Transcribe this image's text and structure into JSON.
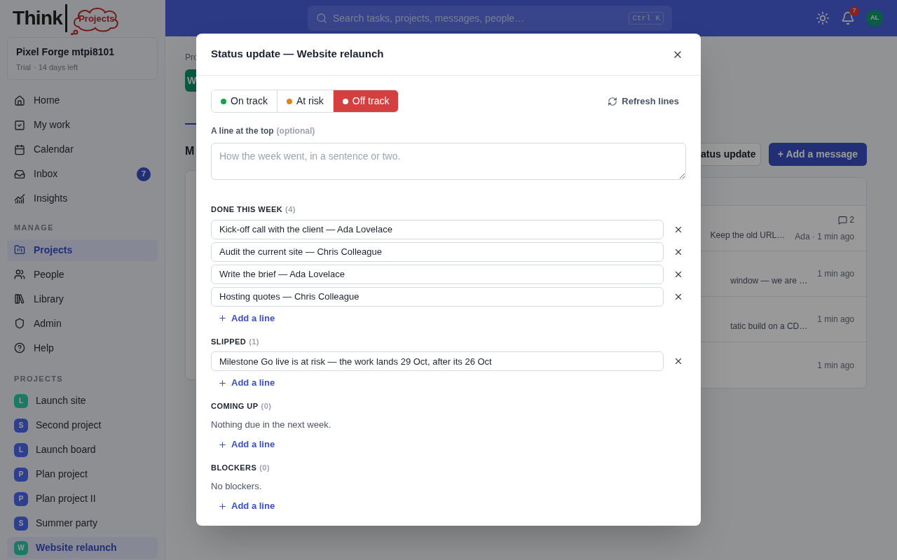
{
  "logo": {
    "word": "Think",
    "badge": "Projects"
  },
  "workspace": {
    "name": "Pixel Forge mtpi8101",
    "plan": "Trial",
    "trial_left": "· 14 days left"
  },
  "nav": [
    {
      "kind": "home",
      "label": "Home",
      "selected": false
    },
    {
      "kind": "work",
      "label": "My work",
      "selected": false
    },
    {
      "kind": "calendar",
      "label": "Calendar",
      "selected": false
    },
    {
      "kind": "inbox",
      "label": "Inbox",
      "badge": "7",
      "selected": false
    },
    {
      "kind": "insights",
      "label": "Insights",
      "selected": false
    }
  ],
  "manage": {
    "heading": "MANAGE",
    "items": [
      {
        "kind": "projects",
        "label": "Projects",
        "selected": true
      },
      {
        "kind": "people",
        "label": "People",
        "selected": false
      },
      {
        "kind": "library",
        "label": "Library",
        "selected": false
      },
      {
        "kind": "admin",
        "label": "Admin",
        "selected": false
      },
      {
        "kind": "help",
        "label": "Help",
        "selected": false
      }
    ]
  },
  "projects": {
    "heading": "PROJECTS",
    "items": [
      {
        "initial": "L",
        "label": "Launch site",
        "color": "#1a7a66",
        "selected": false
      },
      {
        "initial": "S",
        "label": "Second project",
        "color": "#2f3f8f",
        "selected": false
      },
      {
        "initial": "L",
        "label": "Launch board",
        "color": "#2f3f8f",
        "selected": false
      },
      {
        "initial": "P",
        "label": "Plan project",
        "color": "#2f3f8f",
        "selected": false
      },
      {
        "initial": "P",
        "label": "Plan project II",
        "color": "#2f3f8f",
        "selected": false
      },
      {
        "initial": "S",
        "label": "Summer party",
        "color": "#2f3f8f",
        "selected": false
      },
      {
        "initial": "W",
        "label": "Website relaunch",
        "color": "#1a7a66",
        "selected": true
      }
    ]
  },
  "topbar": {
    "search_placeholder": "Search tasks, projects, messages, people…",
    "shortcut": "Ctrl K",
    "notifications": "7",
    "avatar": "AL"
  },
  "background": {
    "breadcrumb": "Pro",
    "tile": "W",
    "heading": "M",
    "status_button": "atus update",
    "add_button": "+ Add a message",
    "rows": [
      {
        "comments": "2",
        "snippet": "Keep the old URL…",
        "meta": "Ada · 1 min ago"
      },
      {
        "snippet": "window — we are …",
        "meta": "1 min ago"
      },
      {
        "snippet": "tatic build on a CD…",
        "meta": "1 min ago"
      },
      {
        "meta": "1 min ago"
      }
    ]
  },
  "modal": {
    "title": "Status update — Website relaunch",
    "statuses": [
      {
        "label": "On track",
        "color": "#16a34a",
        "selected": false
      },
      {
        "label": "At risk",
        "color": "#d98a0b",
        "selected": false
      },
      {
        "label": "Off track",
        "color": "#d43f3f",
        "selected": true
      }
    ],
    "refresh": "Refresh lines",
    "summary_label": "A line at the top",
    "summary_hint": "(optional)",
    "summary_placeholder": "How the week went, in a sentence or two.",
    "sections": [
      {
        "title": "DONE THIS WEEK",
        "count": "(4)",
        "lines": [
          "Kick-off call with the client — Ada Lovelace",
          "Audit the current site — Chris Colleague",
          "Write the brief — Ada Lovelace",
          "Hosting quotes — Chris Colleague"
        ],
        "add": "Add a line"
      },
      {
        "title": "SLIPPED",
        "count": "(1)",
        "lines": [
          "Milestone Go live is at risk — the work lands 29 Oct, after its 26 Oct"
        ],
        "add": "Add a line"
      },
      {
        "title": "COMING UP",
        "count": "(0)",
        "empty": "Nothing due in the next week.",
        "add": "Add a line"
      },
      {
        "title": "BLOCKERS",
        "count": "(0)",
        "empty": "No blockers.",
        "add": "Add a line"
      }
    ]
  }
}
